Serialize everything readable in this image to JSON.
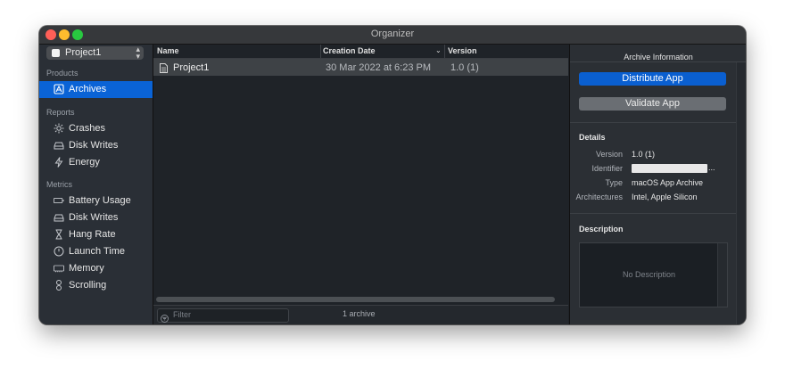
{
  "window": {
    "title": "Organizer"
  },
  "sidebar": {
    "project_selector": {
      "label": "Project1"
    },
    "sections": [
      {
        "title": "Products",
        "items": [
          {
            "label": "Archives",
            "icon": "archive-icon",
            "selected": true
          }
        ]
      },
      {
        "title": "Reports",
        "items": [
          {
            "label": "Crashes",
            "icon": "crash-icon"
          },
          {
            "label": "Disk Writes",
            "icon": "disk-icon"
          },
          {
            "label": "Energy",
            "icon": "energy-bolt-icon"
          }
        ]
      },
      {
        "title": "Metrics",
        "items": [
          {
            "label": "Battery Usage",
            "icon": "battery-icon"
          },
          {
            "label": "Disk Writes",
            "icon": "disk-icon"
          },
          {
            "label": "Hang Rate",
            "icon": "hourglass-icon"
          },
          {
            "label": "Launch Time",
            "icon": "clock-icon"
          },
          {
            "label": "Memory",
            "icon": "memory-chip-icon"
          },
          {
            "label": "Scrolling",
            "icon": "scroll-icon"
          }
        ]
      }
    ]
  },
  "archives_table": {
    "columns": [
      "Name",
      "Creation Date",
      "Version"
    ],
    "sort_indicator": "⌄",
    "rows": [
      {
        "name": "Project1",
        "creation_date": "30 Mar 2022 at 6:23 PM",
        "version": "1.0 (1)"
      }
    ]
  },
  "bottom_bar": {
    "filter_placeholder": "Filter",
    "count_text": "1 archive"
  },
  "archive_info": {
    "header": "Archive Information",
    "distribute_button": "Distribute App",
    "validate_button": "Validate App",
    "details_title": "Details",
    "details": {
      "version_label": "Version",
      "version_value": "1.0 (1)",
      "identifier_label": "Identifier",
      "identifier_ellipsis": "...",
      "type_label": "Type",
      "type_value": "macOS App Archive",
      "architectures_label": "Architectures",
      "architectures_value": "Intel, Apple Silicon"
    },
    "description_title": "Description",
    "description_placeholder": "No Description"
  },
  "colors": {
    "accent": "#0a63d6",
    "window_bg": "#1f2328",
    "sidebar_bg": "#2a2f36",
    "close": "#fe5f57",
    "minimize": "#febc2e",
    "zoom": "#28c840"
  }
}
